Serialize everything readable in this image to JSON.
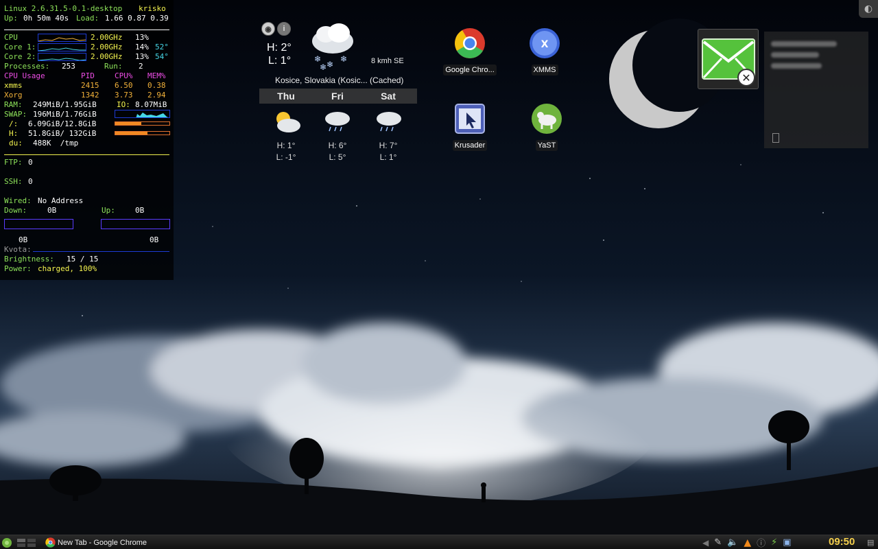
{
  "conky": {
    "kernel": "Linux 2.6.31.5-0.1-desktop",
    "user": "krisko",
    "uptime_label": "Up:",
    "uptime": "0h 50m 40s",
    "load_label": "Load:",
    "load": "1.66 0.87 0.39",
    "cpu_label": "CPU",
    "cpu_freq": "2.00GHz",
    "cpu_pct": "13%",
    "core1_label": "Core 1:",
    "core1_freq": "2.00GHz",
    "core1_pct": "14%",
    "core1_temp": "52°",
    "core2_label": "Core 2:",
    "core2_freq": "2.00GHz",
    "core2_pct": "13%",
    "core2_temp": "54°",
    "processes_label": "Processes:",
    "processes": "253",
    "run_label": "Run:",
    "run": "2",
    "usage_header": "CPU Usage",
    "pid_header": "PID",
    "cpupct_header": "CPU%",
    "mempct_header": "MEM%",
    "procs": [
      {
        "name": "xmms",
        "pid": "2415",
        "cpu": "6.50",
        "mem": "0.38"
      },
      {
        "name": "Xorg",
        "pid": "1342",
        "cpu": "3.73",
        "mem": "2.94"
      }
    ],
    "ram_label": "RAM:",
    "ram": "249MiB/1.95GiB",
    "io_label": "IO:",
    "io": "8.07MiB",
    "swap_label": "SWAP:",
    "swap": "196MiB/1.76GiB",
    "root_label": "/:",
    "root": "6.09GiB/12.8GiB",
    "root_fill": 0.48,
    "home_label": "H:",
    "home": "51.8GiB/ 132GiB",
    "home_fill": 0.6,
    "du_label": "du:",
    "du": "488K  /tmp",
    "ftp_label": "FTP:",
    "ftp": "0",
    "ssh_label": "SSH:",
    "ssh": "0",
    "wired_label": "Wired:",
    "wired": "No Address",
    "down_label": "Down:",
    "down": "0B",
    "up_label": "Up:",
    "up": "0B",
    "down_total": "0B",
    "up_total": "0B",
    "kvota_label": "Kvota:",
    "brightness_label": "Brightness:",
    "brightness": "15 / 15",
    "power_label": "Power:",
    "power": "charged, 100%"
  },
  "weather": {
    "high_now": "H: 2°",
    "low_now": "L: 1°",
    "wind": "8 kmh SE",
    "location": "Kosice, Slovakia (Kosic... (Cached)",
    "days": [
      {
        "day": "Thu",
        "high": "H: 1°",
        "low": "L: -1°"
      },
      {
        "day": "Fri",
        "high": "H: 6°",
        "low": "L: 5°"
      },
      {
        "day": "Sat",
        "high": "H: 7°",
        "low": "L: 1°"
      }
    ]
  },
  "desktop_icons": {
    "chrome": "Google Chro...",
    "xmms": "XMMS",
    "krusader": "Krusader",
    "yast": "YaST"
  },
  "taskbar": {
    "task_title": "New Tab - Google Chrome",
    "clock": "09:50"
  },
  "colors": {
    "conky_green": "#8ee35a",
    "conky_yellow": "#f4f44f",
    "conky_magenta": "#ee4ee6",
    "conky_orange": "#f3b23a",
    "conky_cyan": "#46d6e6",
    "clock": "#f4cf4c"
  }
}
